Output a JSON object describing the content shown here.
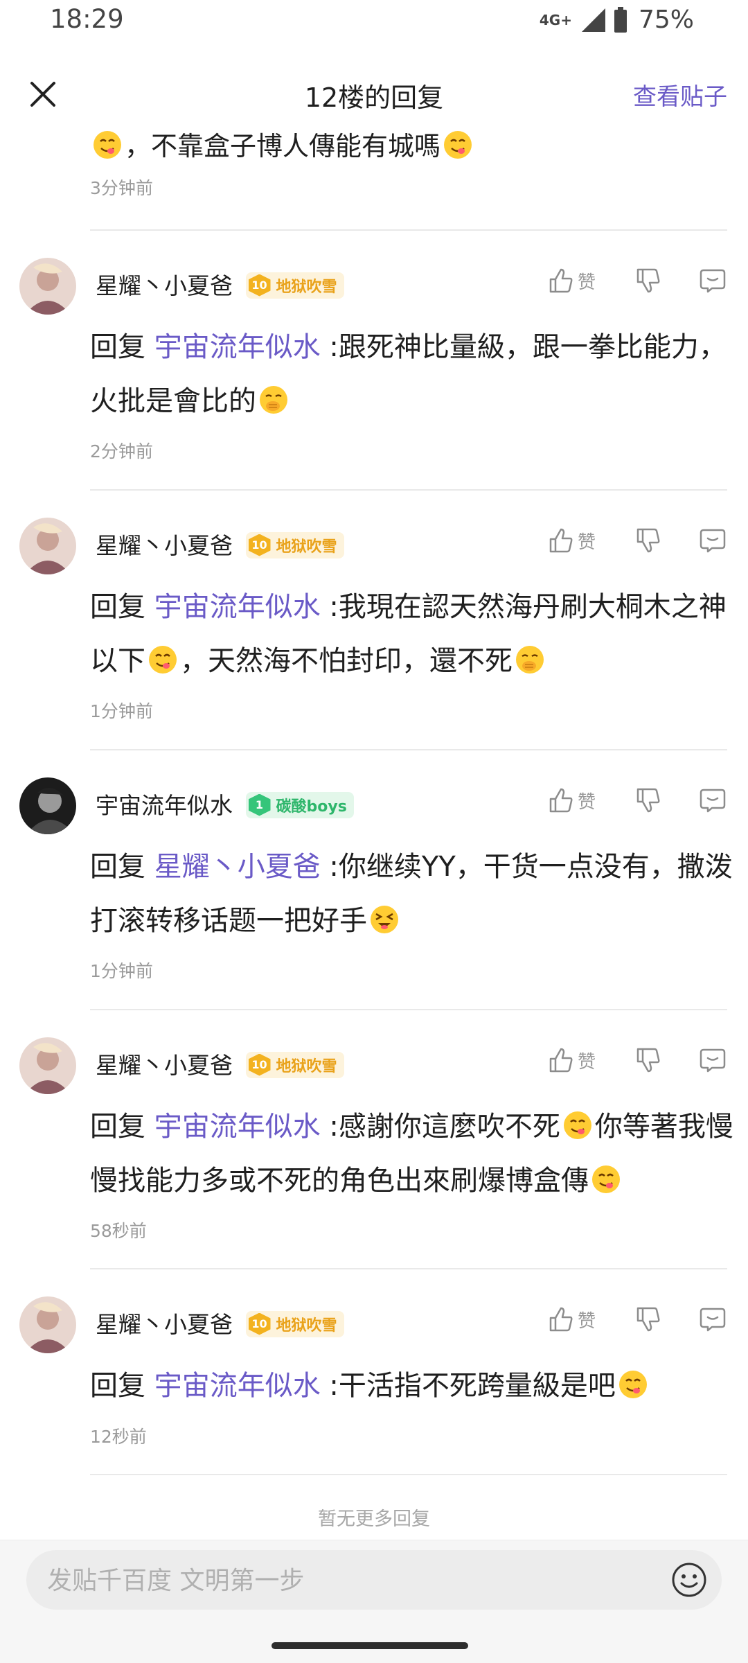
{
  "status_bar": {
    "time": "18:29",
    "network": "4G+",
    "battery": "75%"
  },
  "header": {
    "title": "12楼的回复",
    "view_post": "查看贴子"
  },
  "partial_comment": {
    "text": "，不靠盒子博人傳能有城嗎",
    "time": "3分钟前"
  },
  "like_label": "赞",
  "comments": [
    {
      "user": "星耀丶小夏爸",
      "level": "10",
      "badge": "地狱吹雪",
      "reply_prefix": "回复",
      "reply_to": "宇宙流年似水",
      "text_a": " :跟死神比量級，跟一拳比能力，火批是會比的",
      "text_b": "",
      "text_c": "",
      "time": "2分钟前"
    },
    {
      "user": "星耀丶小夏爸",
      "level": "10",
      "badge": "地狱吹雪",
      "reply_prefix": "回复",
      "reply_to": "宇宙流年似水",
      "text_a": " :我現在認天然海丹刷大桐木之神以下",
      "text_b": "，天然海不怕封印，還不死",
      "text_c": "",
      "time": "1分钟前"
    },
    {
      "user": "宇宙流年似水",
      "level": "1",
      "badge": "碳酸boys",
      "reply_prefix": "回复",
      "reply_to": "星耀丶小夏爸",
      "text_a": " :你继续YY，干货一点没有，撒泼打滚转移话题一把好手",
      "text_b": "",
      "text_c": "",
      "time": "1分钟前"
    },
    {
      "user": "星耀丶小夏爸",
      "level": "10",
      "badge": "地狱吹雪",
      "reply_prefix": "回复",
      "reply_to": "宇宙流年似水",
      "text_a": " :感謝你這麼吹不死",
      "text_b": "你等著我慢慢找能力多或不死的角色出來刷爆博盒傳",
      "text_c": "",
      "time": "58秒前"
    },
    {
      "user": "星耀丶小夏爸",
      "level": "10",
      "badge": "地狱吹雪",
      "reply_prefix": "回复",
      "reply_to": "宇宙流年似水",
      "text_a": " :干活指不死跨量級是吧",
      "text_b": "",
      "text_c": "",
      "time": "12秒前"
    }
  ],
  "footer": {
    "no_more": "暂无更多回复",
    "input_placeholder": "发贴千百度 文明第一步"
  },
  "colors": {
    "accent": "#6a5ac7",
    "gold_badge": "#f3b21f",
    "green_badge": "#35c57a"
  },
  "icons": [
    "close-icon",
    "thumbs-up-icon",
    "thumbs-down-icon",
    "reply-bubble-icon",
    "emoji-icon",
    "signal-icon",
    "battery-icon"
  ]
}
